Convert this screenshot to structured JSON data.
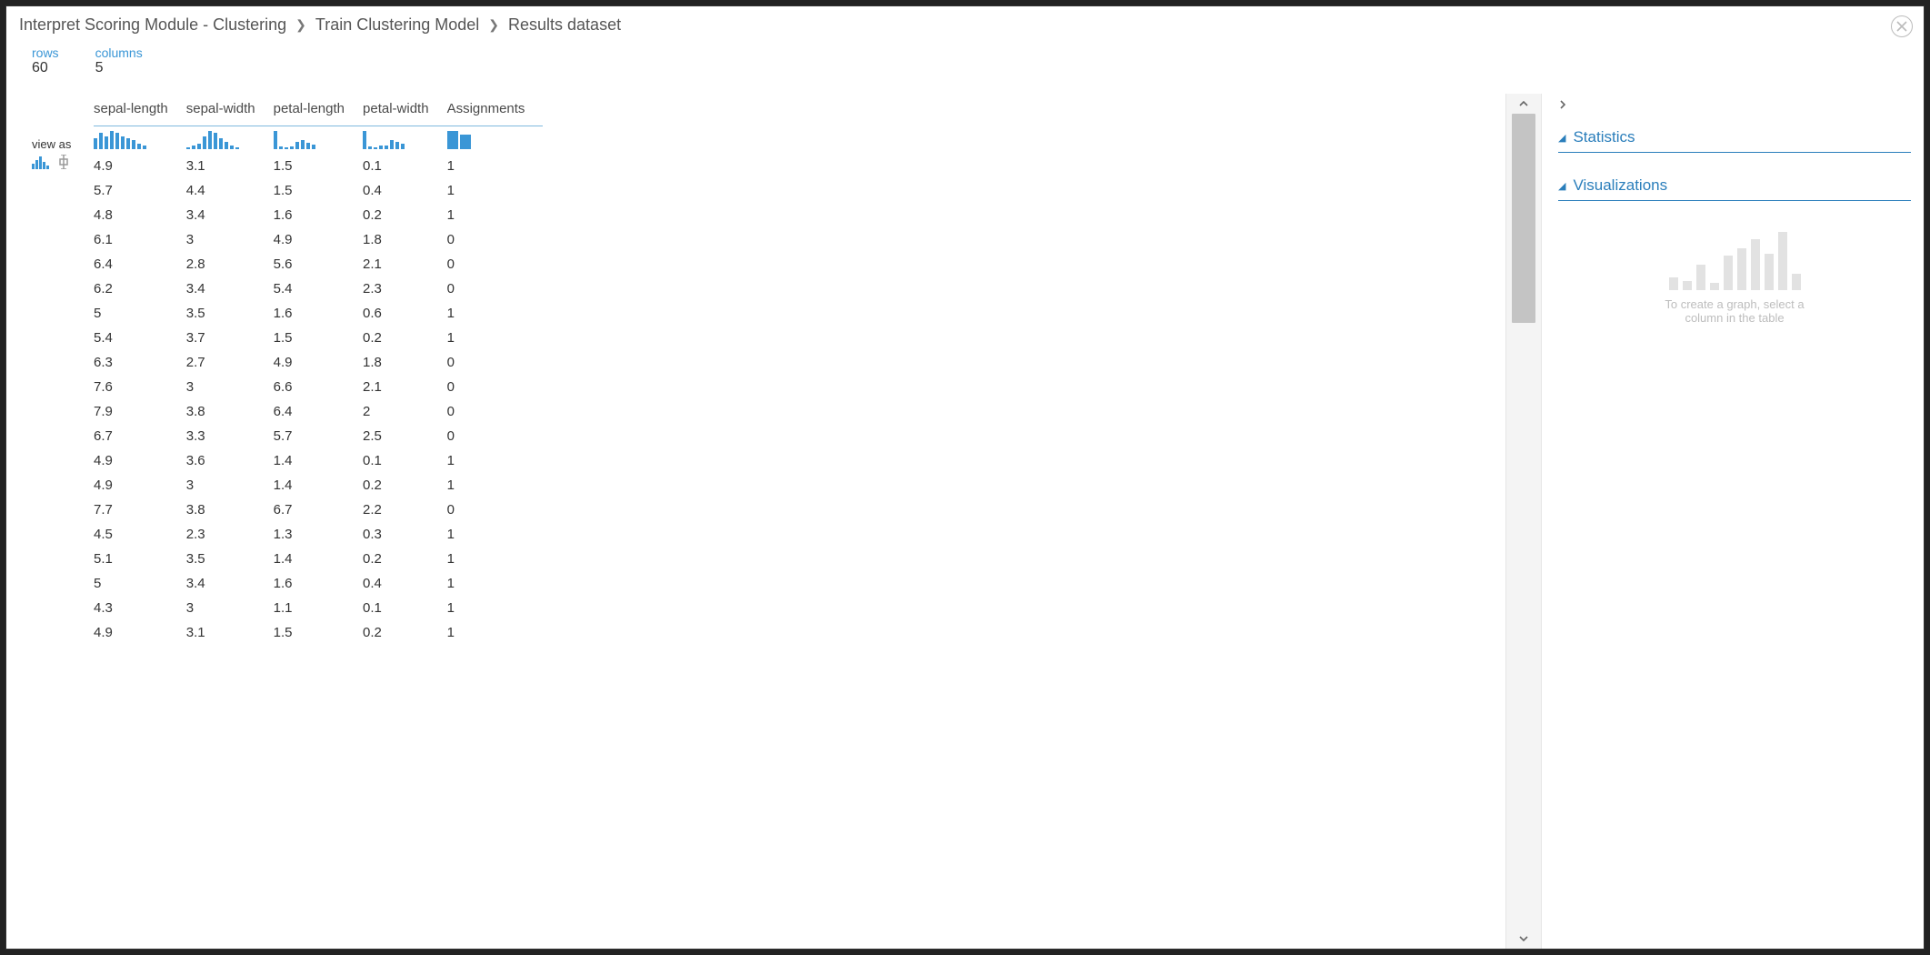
{
  "breadcrumb": {
    "a": "Interpret Scoring Module - Clustering",
    "b": "Train Clustering Model",
    "c": "Results dataset"
  },
  "meta": {
    "rows_label": "rows",
    "rows_value": "60",
    "cols_label": "columns",
    "cols_value": "5"
  },
  "viewas": {
    "label": "view as"
  },
  "table": {
    "columns": [
      "sepal-length",
      "sepal-width",
      "petal-length",
      "petal-width",
      "Assignments"
    ],
    "sparks": [
      [
        12,
        18,
        14,
        20,
        18,
        14,
        12,
        10,
        6,
        4
      ],
      [
        2,
        4,
        6,
        14,
        20,
        18,
        12,
        8,
        4,
        2
      ],
      [
        20,
        3,
        2,
        3,
        8,
        10,
        7,
        5
      ],
      [
        20,
        3,
        2,
        4,
        4,
        10,
        8,
        6
      ],
      [
        20,
        16
      ]
    ],
    "rows": [
      [
        "4.9",
        "3.1",
        "1.5",
        "0.1",
        "1"
      ],
      [
        "5.7",
        "4.4",
        "1.5",
        "0.4",
        "1"
      ],
      [
        "4.8",
        "3.4",
        "1.6",
        "0.2",
        "1"
      ],
      [
        "6.1",
        "3",
        "4.9",
        "1.8",
        "0"
      ],
      [
        "6.4",
        "2.8",
        "5.6",
        "2.1",
        "0"
      ],
      [
        "6.2",
        "3.4",
        "5.4",
        "2.3",
        "0"
      ],
      [
        "5",
        "3.5",
        "1.6",
        "0.6",
        "1"
      ],
      [
        "5.4",
        "3.7",
        "1.5",
        "0.2",
        "1"
      ],
      [
        "6.3",
        "2.7",
        "4.9",
        "1.8",
        "0"
      ],
      [
        "7.6",
        "3",
        "6.6",
        "2.1",
        "0"
      ],
      [
        "7.9",
        "3.8",
        "6.4",
        "2",
        "0"
      ],
      [
        "6.7",
        "3.3",
        "5.7",
        "2.5",
        "0"
      ],
      [
        "4.9",
        "3.6",
        "1.4",
        "0.1",
        "1"
      ],
      [
        "4.9",
        "3",
        "1.4",
        "0.2",
        "1"
      ],
      [
        "7.7",
        "3.8",
        "6.7",
        "2.2",
        "0"
      ],
      [
        "4.5",
        "2.3",
        "1.3",
        "0.3",
        "1"
      ],
      [
        "5.1",
        "3.5",
        "1.4",
        "0.2",
        "1"
      ],
      [
        "5",
        "3.4",
        "1.6",
        "0.4",
        "1"
      ],
      [
        "4.3",
        "3",
        "1.1",
        "0.1",
        "1"
      ],
      [
        "4.9",
        "3.1",
        "1.5",
        "0.2",
        "1"
      ]
    ]
  },
  "right": {
    "stats_label": "Statistics",
    "viz_label": "Visualizations",
    "viz_hint_1": "To create a graph, select a",
    "viz_hint_2": "column in the table",
    "placeholder_bars": [
      14,
      10,
      28,
      8,
      38,
      46,
      56,
      40,
      64,
      18
    ]
  }
}
